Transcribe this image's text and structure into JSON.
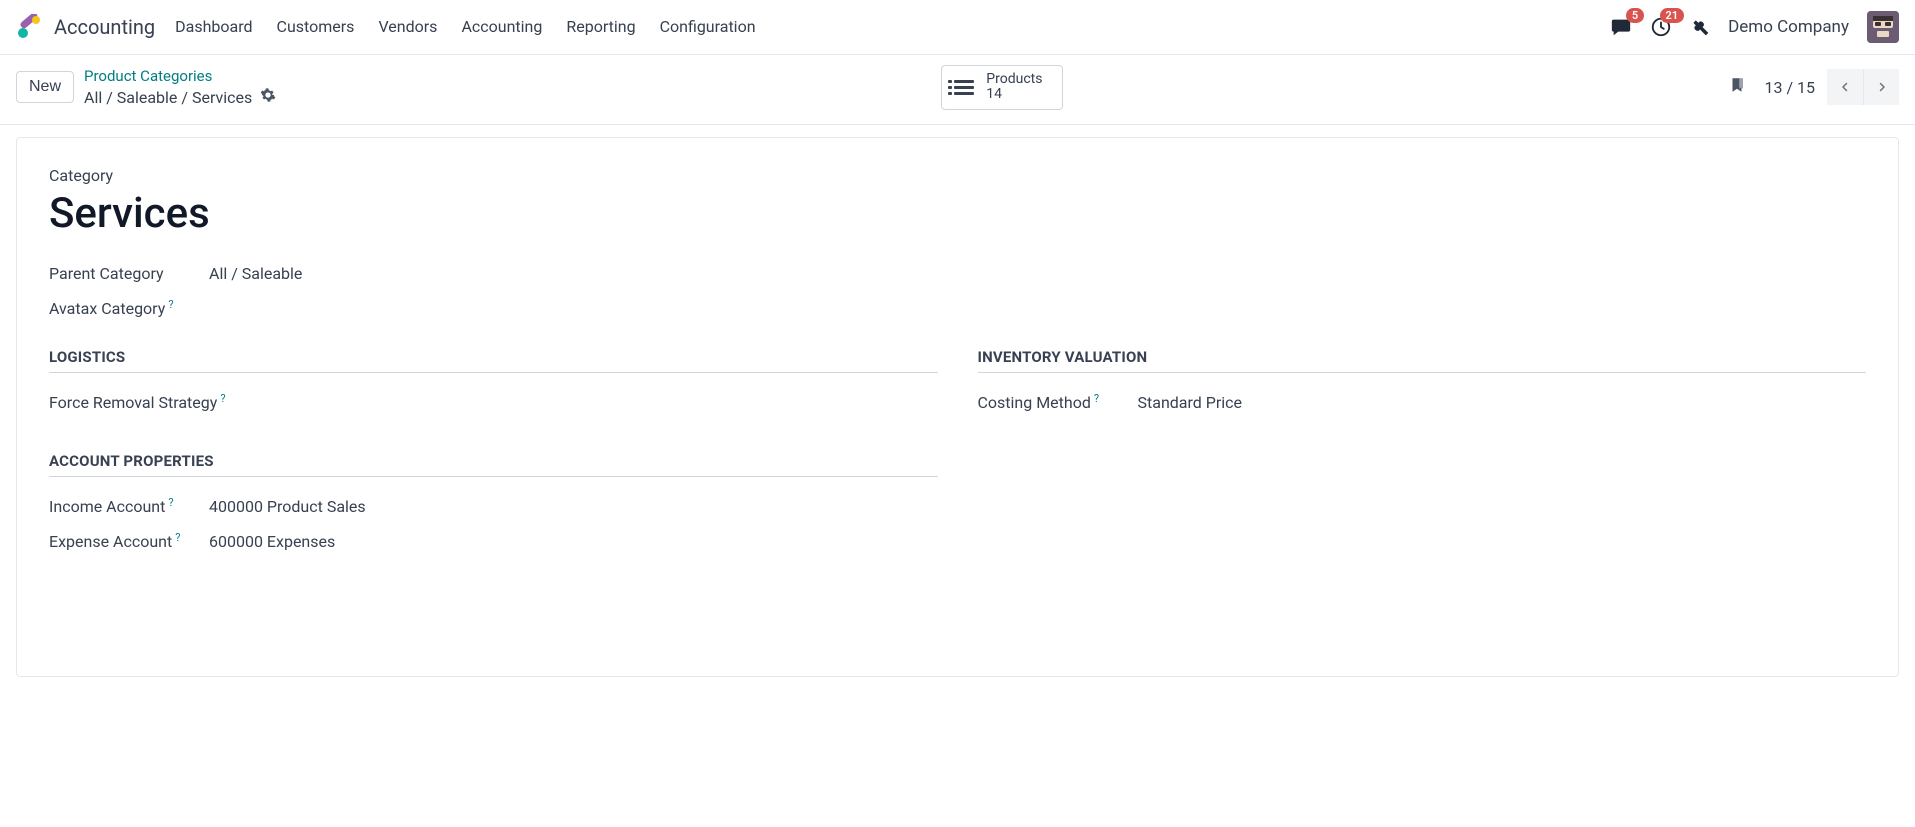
{
  "app": {
    "name": "Accounting"
  },
  "menu": {
    "items": [
      {
        "label": "Dashboard"
      },
      {
        "label": "Customers"
      },
      {
        "label": "Vendors"
      },
      {
        "label": "Accounting"
      },
      {
        "label": "Reporting"
      },
      {
        "label": "Configuration"
      }
    ]
  },
  "header": {
    "messages_badge": "5",
    "activities_badge": "21",
    "company": "Demo Company"
  },
  "control": {
    "new_label": "New",
    "breadcrumb_link": "Product Categories",
    "breadcrumb_path": "All / Saleable / Services",
    "stat": {
      "label": "Products",
      "value": "14"
    },
    "pager": {
      "current": "13",
      "total": "15",
      "sep": " / "
    }
  },
  "form": {
    "category_label": "Category",
    "name": "Services",
    "parent_label": "Parent Category",
    "parent_value": "All / Saleable",
    "avatax_label": "Avatax Category",
    "logistics_title": "LOGISTICS",
    "removal_label": "Force Removal Strategy",
    "inventory_title": "INVENTORY VALUATION",
    "costing_label": "Costing Method",
    "costing_value": "Standard Price",
    "account_title": "ACCOUNT PROPERTIES",
    "income_label": "Income Account",
    "income_value": "400000 Product Sales",
    "expense_label": "Expense Account",
    "expense_value": "600000 Expenses"
  }
}
